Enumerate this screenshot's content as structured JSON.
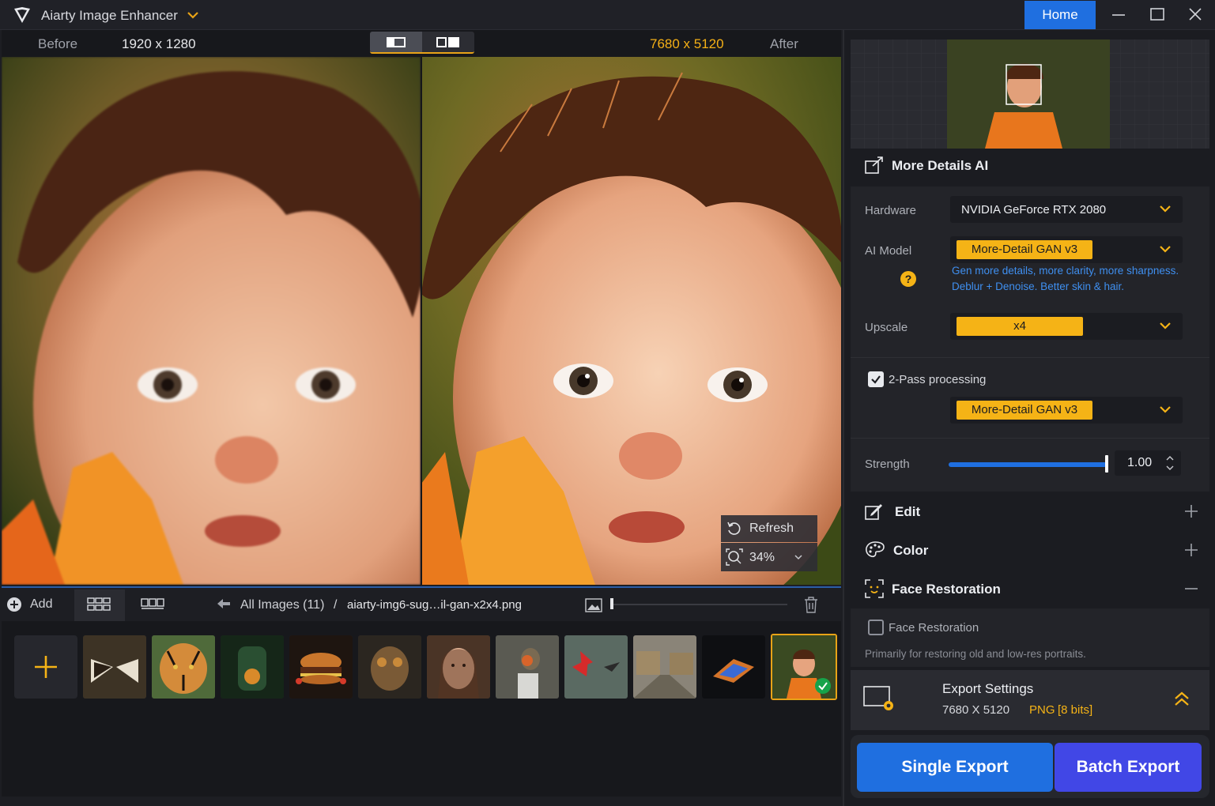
{
  "app": {
    "title": "Aiarty Image Enhancer",
    "home_label": "Home"
  },
  "compare": {
    "before_label": "Before",
    "before_resolution": "1920 x 1280",
    "after_resolution": "7680 x 5120",
    "after_label": "After"
  },
  "overlay": {
    "refresh_label": "Refresh",
    "zoom": "34%"
  },
  "toolbar": {
    "add_label": "Add",
    "breadcrumb_all": "All Images (11)",
    "breadcrumb_sep": "/",
    "breadcrumb_file": "aiarty-img6-sug…il-gan-x2x4.png"
  },
  "thumbnails": [
    {
      "name": "butterfly"
    },
    {
      "name": "tiger"
    },
    {
      "name": "jar-plant"
    },
    {
      "name": "burger"
    },
    {
      "name": "steampunk-dog"
    },
    {
      "name": "woman-portrait"
    },
    {
      "name": "robin-bird"
    },
    {
      "name": "red-flower-hummingbird"
    },
    {
      "name": "village-street"
    },
    {
      "name": "butterfly-dark"
    },
    {
      "name": "child-portrait",
      "selected": true
    }
  ],
  "panel": {
    "more_details": {
      "title": "More Details AI",
      "hardware_label": "Hardware",
      "hardware_value": "NVIDIA GeForce RTX 2080",
      "ai_model_label": "AI Model",
      "ai_model_value": "More-Detail GAN  v3",
      "model_desc_1": "Gen more details, more clarity, more sharpness.",
      "model_desc_2": "Deblur + Denoise. Better skin & hair.",
      "upscale_label": "Upscale",
      "upscale_value": "x4",
      "two_pass_label": "2-Pass processing",
      "two_pass_checked": true,
      "two_pass_model": "More-Detail GAN  v3",
      "strength_label": "Strength",
      "strength_value": "1.00",
      "strength_fraction": 1.0
    },
    "edit_title": "Edit",
    "color_title": "Color",
    "face_restoration_title": "Face Restoration",
    "face_restoration_checkbox": "Face Restoration",
    "face_restoration_checked": false,
    "face_restoration_hint": "Primarily for restoring old and low-res portraits.",
    "export_settings": {
      "title": "Export Settings",
      "resolution": "7680 X 5120",
      "format": "PNG",
      "bits": "[8 bits]"
    },
    "single_export": "Single Export",
    "batch_export": "Batch Export"
  },
  "colors": {
    "accent_blue": "#1f6fe0",
    "accent_orange": "#f5b316",
    "batch_purple": "#4147e6",
    "link_blue": "#3f8ff0"
  }
}
